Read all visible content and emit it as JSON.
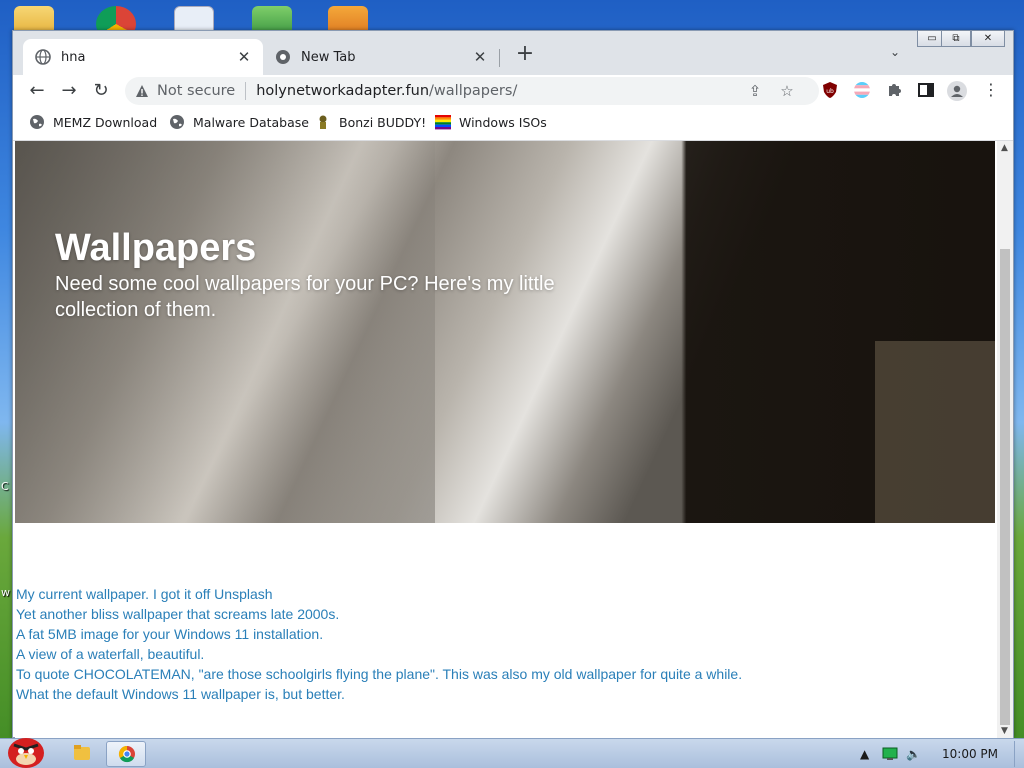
{
  "desktop": {
    "partial_labels": [
      "C",
      "w"
    ]
  },
  "browser": {
    "tabs": [
      {
        "label": "hna",
        "active": true
      },
      {
        "label": "New Tab",
        "active": false
      }
    ],
    "window_controls": {
      "minimize": "▭",
      "restore": "⧉",
      "close": "✕"
    },
    "toolbar": {
      "not_secure": "Not secure",
      "url_host": "holynetworkadapter.fun",
      "url_path": "/wallpapers/"
    },
    "bookmarks": [
      {
        "label": "MEMZ Download",
        "icon": "globe-icon"
      },
      {
        "label": "Malware Database",
        "icon": "globe-icon"
      },
      {
        "label": "Bonzi BUDDY!",
        "icon": "bonzi-icon"
      },
      {
        "label": "Windows ISOs",
        "icon": "rainbow-flag-icon"
      }
    ]
  },
  "page": {
    "hero_title": "Wallpapers",
    "hero_subtitle": "Need some cool wallpapers for your PC? Here's my little collection of them.",
    "links": [
      "My current wallpaper. I got it off Unsplash",
      "Yet another bliss wallpaper that screams late 2000s.",
      "A fat 5MB image for your Windows 11 installation.",
      "A view of a waterfall, beautiful.",
      "To quote CHOCOLATEMAN, \"are those schoolgirls flying the plane\". This was also my old wallpaper for quite a while.",
      "What the default Windows 11 wallpaper is, but better."
    ]
  },
  "taskbar": {
    "clock": "10:00 PM"
  },
  "colors": {
    "link": "#2a7fb8",
    "tabstrip": "#dfe3e8",
    "omnibox": "#f1f3f4"
  }
}
